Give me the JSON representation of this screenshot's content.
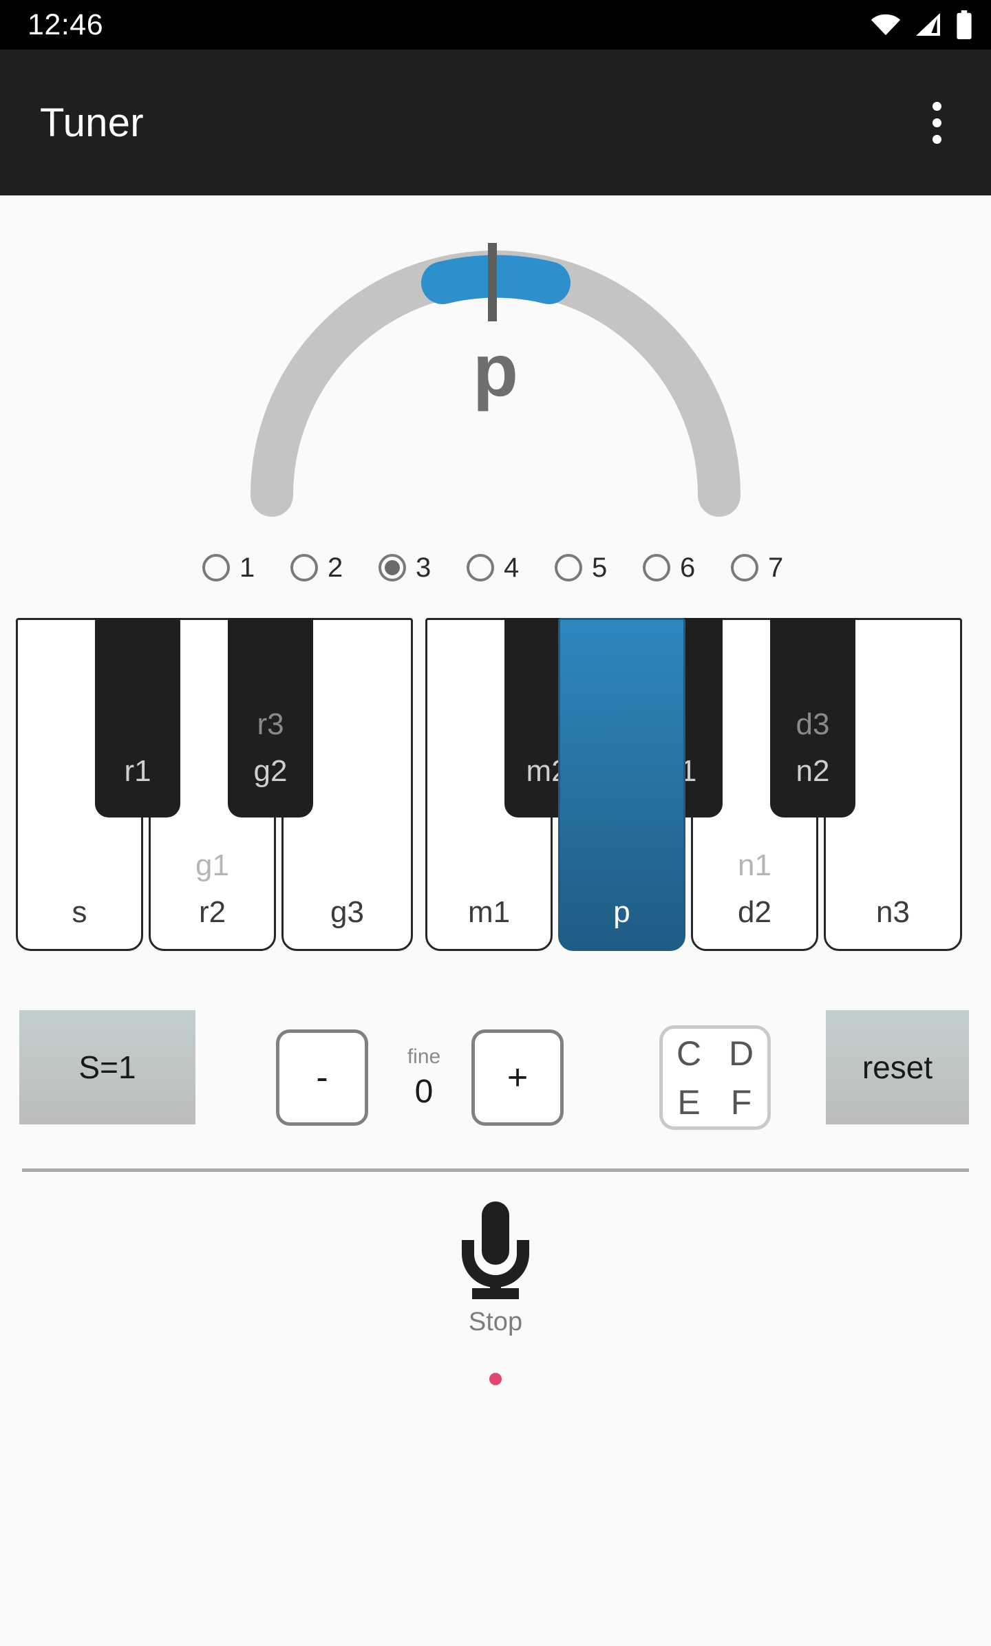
{
  "statusbar": {
    "clock": "12:46",
    "icons": [
      "wifi-icon",
      "cellular-signal-icon",
      "battery-icon"
    ]
  },
  "appbar": {
    "title": "Tuner",
    "overflow_label": "overflow-menu-icon"
  },
  "gauge": {
    "note": "p",
    "needle_position_deg": 1,
    "segment_center_deg": -3,
    "segment_width_deg": 28,
    "track_color": "#c4c4c4",
    "segment_color": "#2d8fcc",
    "needle_color": "#5e5e5e"
  },
  "octaves": {
    "options": [
      "1",
      "2",
      "3",
      "4",
      "5",
      "6",
      "7"
    ],
    "selected": "3"
  },
  "keyboard": {
    "accent_color": "#2f87bf",
    "active_key": "p",
    "groups": [
      {
        "name": "group-left",
        "white_keys": [
          {
            "label": "s",
            "alt": "",
            "active": false
          },
          {
            "label": "r2",
            "alt": "g1",
            "active": false
          },
          {
            "label": "g3",
            "alt": "",
            "active": false
          }
        ],
        "black_keys": [
          {
            "label": "r1",
            "alt": ""
          },
          {
            "label": "g2",
            "alt": "r3"
          }
        ]
      },
      {
        "name": "group-right",
        "white_keys": [
          {
            "label": "m1",
            "alt": "",
            "active": false
          },
          {
            "label": "p",
            "alt": "",
            "active": true
          },
          {
            "label": "d2",
            "alt": "n1",
            "active": false
          },
          {
            "label": "n3",
            "alt": "",
            "active": false
          }
        ],
        "black_keys": [
          {
            "label": "m2",
            "alt": ""
          },
          {
            "label": "d1",
            "alt": ""
          },
          {
            "label": "n2",
            "alt": "d3"
          }
        ]
      }
    ]
  },
  "controls": {
    "shruti_label": "S=1",
    "minus_label": "-",
    "plus_label": "+",
    "fine_label": "fine",
    "fine_value": "0",
    "notes": [
      "C",
      "D",
      "E",
      "F"
    ],
    "reset_label": "reset"
  },
  "recorder": {
    "icon": "microphone-icon",
    "action_label": "Stop",
    "recording_indicator_color": "#e0456c"
  }
}
